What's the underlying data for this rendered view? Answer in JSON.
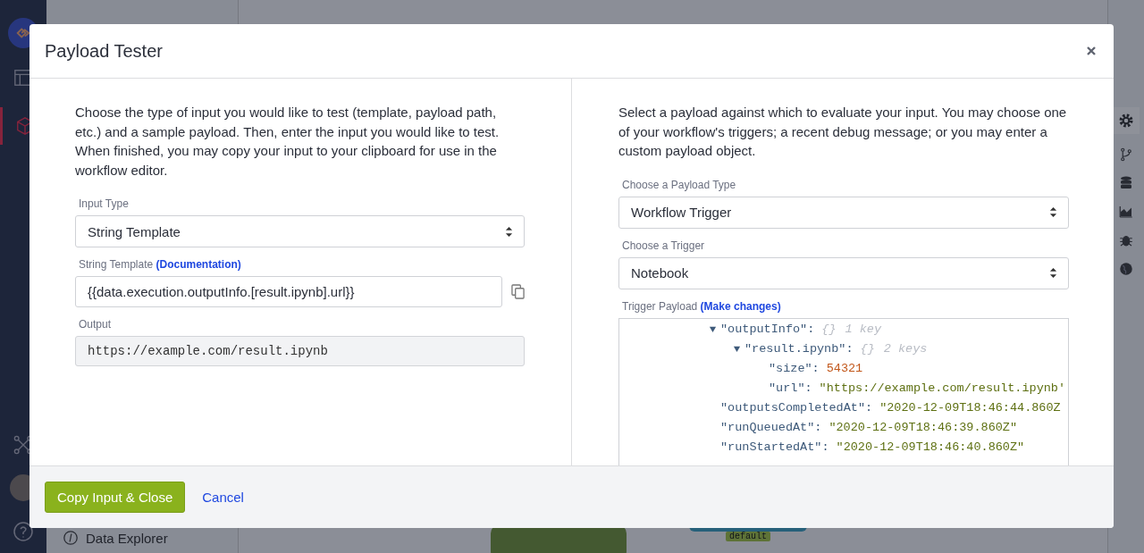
{
  "background": {
    "nav_items": [
      {
        "label": "Data Explorer"
      }
    ],
    "port_label": "default"
  },
  "modal": {
    "title": "Payload Tester",
    "left": {
      "intro": "Choose the type of input you would like to test (template, payload path, etc.) and a sample payload. Then, enter the input you would like to test. When finished, you may copy your input to your clipboard for use in the workflow editor.",
      "input_type": {
        "label": "Input Type",
        "value": "String Template"
      },
      "template": {
        "label": "String Template",
        "link": "(Documentation)",
        "value": "{{data.execution.outputInfo.[result.ipynb].url}}"
      },
      "output": {
        "label": "Output",
        "value": "https://example.com/result.ipynb"
      }
    },
    "right": {
      "intro": "Select a payload against which to evaluate your input. You may choose one of your workflow's triggers; a recent debug message; or you may enter a custom payload object.",
      "payload_type": {
        "label": "Choose a Payload Type",
        "value": "Workflow Trigger"
      },
      "trigger": {
        "label": "Choose a Trigger",
        "value": "Notebook"
      },
      "payload": {
        "label": "Trigger Payload",
        "link": "(Make changes)",
        "nodes": [
          {
            "key": "\"outputInfo\":",
            "kind": "object",
            "expanded": true,
            "braces": "{}",
            "meta": "1 key",
            "children": [
              {
                "key": "\"result.ipynb\":",
                "kind": "object",
                "expanded": true,
                "braces": "{}",
                "meta": "2 keys",
                "children": [
                  {
                    "key": "\"size\":",
                    "kind": "number",
                    "value": "54321"
                  },
                  {
                    "key": "\"url\":",
                    "kind": "string",
                    "value": "\"https://example.com/result.ipynb'"
                  }
                ]
              }
            ]
          },
          {
            "key": "\"outputsCompletedAt\":",
            "kind": "string",
            "value": "\"2020-12-09T18:46:44.860Z"
          },
          {
            "key": "\"runQueuedAt\":",
            "kind": "string",
            "value": "\"2020-12-09T18:46:39.860Z\""
          },
          {
            "key": "\"runStartedAt\":",
            "kind": "string",
            "value": "\"2020-12-09T18:46:40.860Z\""
          }
        ]
      }
    },
    "buttons": [
      {
        "label": "Copy Input & Close",
        "kind": "primary"
      },
      {
        "label": "Cancel",
        "kind": "link"
      }
    ]
  }
}
